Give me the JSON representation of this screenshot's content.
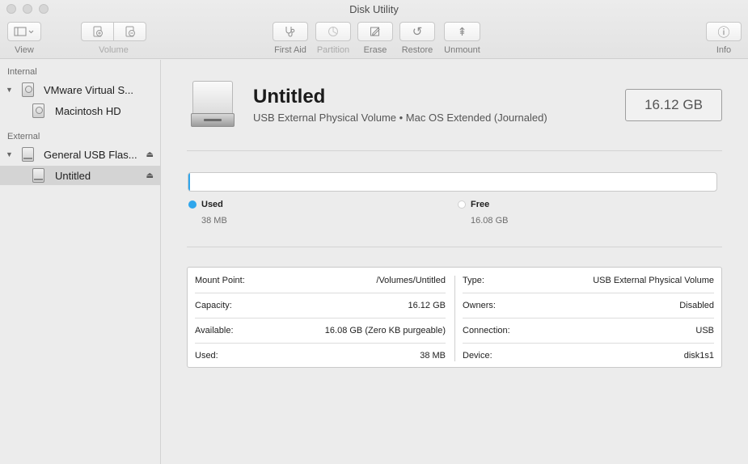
{
  "window": {
    "title": "Disk Utility"
  },
  "toolbar": {
    "view": {
      "label": "View"
    },
    "volume": {
      "label": "Volume"
    },
    "first_aid": {
      "label": "First Aid",
      "icon": "stethoscope-icon"
    },
    "partition": {
      "label": "Partition",
      "icon": "pie-icon"
    },
    "erase": {
      "label": "Erase",
      "icon": "pencil-icon"
    },
    "restore": {
      "label": "Restore",
      "icon": "restore-icon",
      "glyph": "↺"
    },
    "unmount": {
      "label": "Unmount",
      "icon": "unmount-icon",
      "glyph": "⇞"
    },
    "info": {
      "label": "Info",
      "icon": "info-icon",
      "glyph": "ⓘ"
    }
  },
  "sidebar": {
    "internal_label": "Internal",
    "external_label": "External",
    "items": [
      {
        "label": "VMware Virtual S...",
        "level": 0,
        "kind": "disk"
      },
      {
        "label": "Macintosh HD",
        "level": 1,
        "kind": "volume"
      },
      {
        "label": "General USB Flas...",
        "level": 0,
        "kind": "disk"
      },
      {
        "label": "Untitled",
        "level": 1,
        "kind": "volume",
        "selected": true
      }
    ]
  },
  "volume": {
    "name": "Untitled",
    "description": "USB External Physical Volume • Mac OS Extended (Journaled)",
    "size": "16.12 GB"
  },
  "usage": {
    "used_fraction": 0.0024,
    "used_color": "#2fa6ec",
    "free_color": "#ffffff",
    "used_label": "Used",
    "used_value": "38 MB",
    "free_label": "Free",
    "free_value": "16.08 GB"
  },
  "details": {
    "left": [
      {
        "key": "Mount Point:",
        "value": "/Volumes/Untitled"
      },
      {
        "key": "Capacity:",
        "value": "16.12 GB"
      },
      {
        "key": "Available:",
        "value": "16.08 GB (Zero KB purgeable)"
      },
      {
        "key": "Used:",
        "value": "38 MB"
      }
    ],
    "right": [
      {
        "key": "Type:",
        "value": "USB External Physical Volume"
      },
      {
        "key": "Owners:",
        "value": "Disabled"
      },
      {
        "key": "Connection:",
        "value": "USB"
      },
      {
        "key": "Device:",
        "value": "disk1s1"
      }
    ]
  }
}
